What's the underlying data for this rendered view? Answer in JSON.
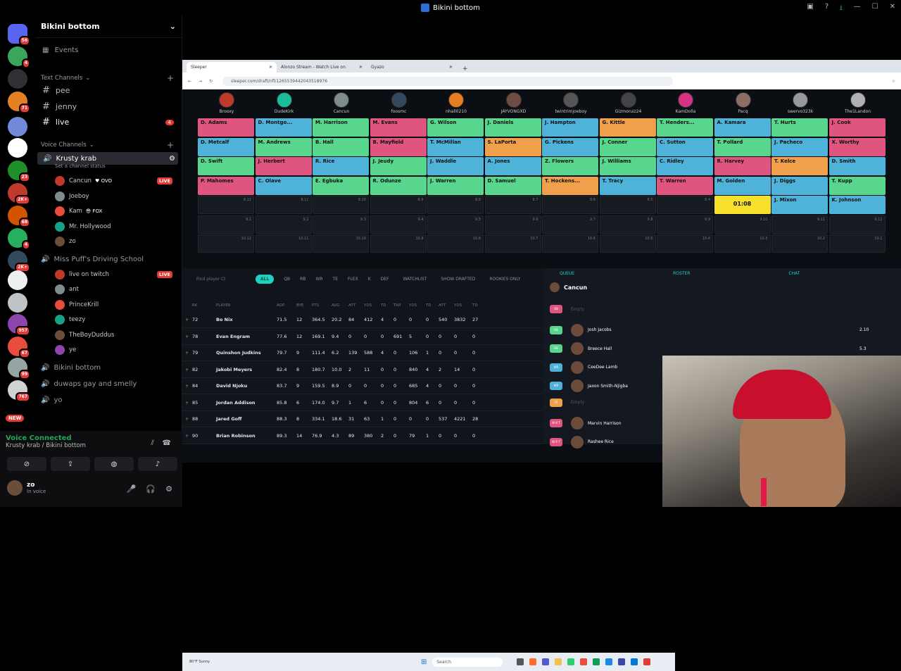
{
  "app": {
    "title": "Bikini bottom"
  },
  "server": {
    "name": "Bikini bottom"
  },
  "servers": [
    {
      "color": "#5865f2",
      "badge": "56"
    },
    {
      "color": "#3ba55c",
      "badge": "4"
    },
    {
      "color": "#2f3136",
      "badge": ""
    },
    {
      "color": "#e67e22",
      "badge": "71"
    },
    {
      "color": "#7289da",
      "badge": ""
    },
    {
      "color": "#ffffff",
      "badge": ""
    },
    {
      "color": "#1e8f2b",
      "badge": "23"
    },
    {
      "color": "#c0392b",
      "badge": "2K+"
    },
    {
      "color": "#d35400",
      "badge": "68"
    },
    {
      "color": "#27ae60",
      "badge": "4"
    },
    {
      "color": "#34495e",
      "badge": "2K+"
    },
    {
      "color": "#ecf0f1",
      "badge": ""
    },
    {
      "color": "#bdc3c7",
      "badge": ""
    },
    {
      "color": "#8e44ad",
      "badge": "957"
    },
    {
      "color": "#e74c3c",
      "badge": "67"
    },
    {
      "color": "#95a5a6",
      "badge": "99"
    },
    {
      "color": "#d0d3d4",
      "badge": "767"
    }
  ],
  "new_label": "NEW",
  "events": "Events",
  "text_category": "Text Channels",
  "voice_category": "Voice Channels",
  "text_channels": [
    {
      "name": "pee"
    },
    {
      "name": "jenny"
    },
    {
      "name": "live",
      "badge": "4"
    }
  ],
  "voice_channels": [
    {
      "name": "Krusty krab",
      "status": "Set a channel status",
      "users": [
        {
          "name": "Cancun",
          "extra": "♥ OVO",
          "live": "LIVE"
        },
        {
          "name": "Joeboy"
        },
        {
          "name": "Kam",
          "extra": "😎 FOX"
        },
        {
          "name": "Mr. Hollywood"
        },
        {
          "name": "zo"
        }
      ]
    },
    {
      "name": "Miss Puff's Driving School",
      "users": [
        {
          "name": "live on twitch",
          "live": "LIVE"
        },
        {
          "name": "ant"
        },
        {
          "name": "PrinceKrill"
        },
        {
          "name": "teezy"
        },
        {
          "name": "TheBoyDuddus"
        },
        {
          "name": "ye"
        }
      ]
    },
    {
      "name": "Bikini bottom"
    },
    {
      "name": "duwaps gay and smelly"
    },
    {
      "name": "yo"
    }
  ],
  "voice_connected": {
    "title": "Voice Connected",
    "sub": "Krusty krab / Bikini bottom"
  },
  "me": {
    "name": "zo",
    "status": "In voice"
  },
  "browser": {
    "tabs": [
      "Sleeper",
      "Alonzo Stream - Watch Live on",
      "Gyazo"
    ],
    "url": "sleeper.com/draft/nfl/1265539442043518976"
  },
  "drafters": [
    "Brooxy",
    "DudeKirk",
    "Cancun",
    "foosmc",
    "nhall0210",
    "JAYVONGXD",
    "twintrimjoeboy",
    "Gizmoruiz24",
    "KamDolla",
    "Pacq",
    "swervo323k",
    "The1Landon"
  ],
  "drafter_colors": [
    "#c0392b",
    "#1abc9c",
    "#7f8c8d",
    "#34495e",
    "#e67e22",
    "#6d4c41",
    "#555",
    "#444",
    "#d63384",
    "#8d6e63",
    "#999",
    "#b0b0b0"
  ],
  "board_rows": [
    [
      "D. Adams",
      "D. Montgo...",
      "M. Harrison",
      "M. Evans",
      "G. Wilson",
      "J. Daniels",
      "J. Hampton",
      "G. Kittle",
      "T. Henders...",
      "A. Kamara",
      "T. Hurts",
      "J. Cook"
    ],
    [
      "D. Metcalf",
      "M. Andrews",
      "B. Hall",
      "B. Mayfield",
      "T. McMillan",
      "S. LaPorta",
      "G. Pickens",
      "J. Conner",
      "C. Sutton",
      "T. Pollard",
      "J. Pacheco",
      "X. Worthy"
    ],
    [
      "D. Swift",
      "J. Herbert",
      "R. Rice",
      "J. Jeudy",
      "J. Waddle",
      "A. Jones",
      "Z. Flowers",
      "J. Williams",
      "C. Ridley",
      "R. Harvey",
      "T. Kelce",
      "D. Smith"
    ],
    [
      "P. Mahomes",
      "C. Olave",
      "E. Egbuka",
      "R. Odunze",
      "J. Warren",
      "D. Samuel",
      "T. Hockens...",
      "T. Tracy",
      "T. Warren",
      "M. Golden",
      "J. Diggs",
      "T. Kupp"
    ]
  ],
  "board_colors": [
    [
      "#e0557f",
      "#4fb3d9",
      "#58d68d",
      "#e0557f",
      "#58d68d",
      "#58d68d",
      "#4fb3d9",
      "#f0a04b",
      "#58d68d",
      "#4fb3d9",
      "#58d68d",
      "#e0557f"
    ],
    [
      "#4fb3d9",
      "#58d68d",
      "#58d68d",
      "#e0557f",
      "#4fb3d9",
      "#f0a04b",
      "#4fb3d9",
      "#58d68d",
      "#4fb3d9",
      "#58d68d",
      "#4fb3d9",
      "#e0557f"
    ],
    [
      "#58d68d",
      "#e0557f",
      "#4fb3d9",
      "#58d68d",
      "#4fb3d9",
      "#4fb3d9",
      "#58d68d",
      "#58d68d",
      "#4fb3d9",
      "#e0557f",
      "#f0a04b",
      "#4fb3d9"
    ],
    [
      "#e0557f",
      "#4fb3d9",
      "#58d68d",
      "#58d68d",
      "#58d68d",
      "#58d68d",
      "#f0a04b",
      "#4fb3d9",
      "#e0557f",
      "#4fb3d9",
      "#4fb3d9",
      "#58d68d"
    ]
  ],
  "row5": [
    "8.12",
    "8.11",
    "8.10",
    "8.9",
    "8.8",
    "8.7",
    "8.6",
    "8.5",
    "8.4",
    "01:08",
    "J. Mixon",
    "K. Johnson"
  ],
  "row6": [
    "9.1",
    "9.2",
    "9.3",
    "9.4",
    "9.5",
    "9.6",
    "9.7",
    "9.8",
    "9.9",
    "9.10",
    "9.11",
    "9.12"
  ],
  "row7": [
    "10.12",
    "10.11",
    "10.10",
    "10.9",
    "10.8",
    "10.7",
    "10.6",
    "10.5",
    "10.4",
    "10.3",
    "10.2",
    "10.1"
  ],
  "filters": {
    "search": "Find player Ct",
    "tabs": [
      "ALL",
      "QB",
      "RB",
      "WR",
      "TE",
      "FLEX",
      "K",
      "DEF"
    ],
    "watchlist": "WATCHLIST",
    "show_drafted": "SHOW DRAFTED",
    "rookies": "ROOKIES ONLY"
  },
  "table_headers": [
    "RK",
    "PLAYER",
    "ADP",
    "BYE",
    "PTS",
    "AVG",
    "ATT",
    "YDS",
    "TD",
    "TAR",
    "YDS",
    "TD",
    "ATT",
    "YDS",
    "TD"
  ],
  "players": [
    [
      "72",
      "Bo Nix",
      "71.5",
      "12",
      "364.5",
      "20.2",
      "84",
      "412",
      "4",
      "0",
      "0",
      "0",
      "540",
      "3832",
      "27"
    ],
    [
      "78",
      "Evan Engram",
      "77.6",
      "12",
      "169.1",
      "9.4",
      "0",
      "0",
      "0",
      "691",
      "5",
      "0",
      "0",
      "0",
      "0"
    ],
    [
      "79",
      "Quinshon Judkins",
      "79.7",
      "9",
      "111.4",
      "6.2",
      "139",
      "588",
      "4",
      "0",
      "106",
      "1",
      "0",
      "0",
      "0"
    ],
    [
      "82",
      "Jakobi Meyers",
      "82.4",
      "8",
      "180.7",
      "10.0",
      "2",
      "11",
      "0",
      "0",
      "840",
      "4",
      "2",
      "14",
      "0"
    ],
    [
      "84",
      "David Njoku",
      "83.7",
      "9",
      "159.5",
      "8.9",
      "0",
      "0",
      "0",
      "0",
      "685",
      "4",
      "0",
      "0",
      "0"
    ],
    [
      "85",
      "Jordan Addison",
      "85.8",
      "6",
      "174.0",
      "9.7",
      "1",
      "6",
      "0",
      "0",
      "804",
      "6",
      "0",
      "0",
      "0"
    ],
    [
      "88",
      "Jared Goff",
      "88.3",
      "8",
      "334.1",
      "18.6",
      "31",
      "63",
      "1",
      "0",
      "0",
      "0",
      "537",
      "4221",
      "28"
    ],
    [
      "90",
      "Brian Robinson",
      "89.3",
      "14",
      "76.9",
      "4.3",
      "89",
      "380",
      "2",
      "0",
      "79",
      "1",
      "0",
      "0",
      "0"
    ]
  ],
  "queue": {
    "tabs": [
      "QUEUE",
      "ROSTER",
      "CHAT"
    ],
    "owner": "Cancun",
    "empty": "Empty",
    "rows": [
      {
        "pos": "QB",
        "color": "#e0557f",
        "name": "",
        "val": ""
      },
      {
        "pos": "RB",
        "color": "#58d68d",
        "name": "Josh Jacobs",
        "val": "2.10"
      },
      {
        "pos": "RB",
        "color": "#58d68d",
        "name": "Breece Hall",
        "val": "5.3"
      },
      {
        "pos": "WR",
        "color": "#4fb3d9",
        "name": "CeeDee Lamb",
        "val": ""
      },
      {
        "pos": "WR",
        "color": "#4fb3d9",
        "name": "Jaxon Smith-Njigba",
        "val": ""
      },
      {
        "pos": "TE",
        "color": "#f0a04b",
        "name": "",
        "val": ""
      },
      {
        "pos": "W R T",
        "color": "#e0557f",
        "name": "Marvin Harrison",
        "val": ""
      },
      {
        "pos": "W R T",
        "color": "#e0557f",
        "name": "Rashee Rice",
        "val": ""
      }
    ]
  },
  "taskbar": {
    "weather": "80°F Sunny",
    "search": "Search"
  }
}
